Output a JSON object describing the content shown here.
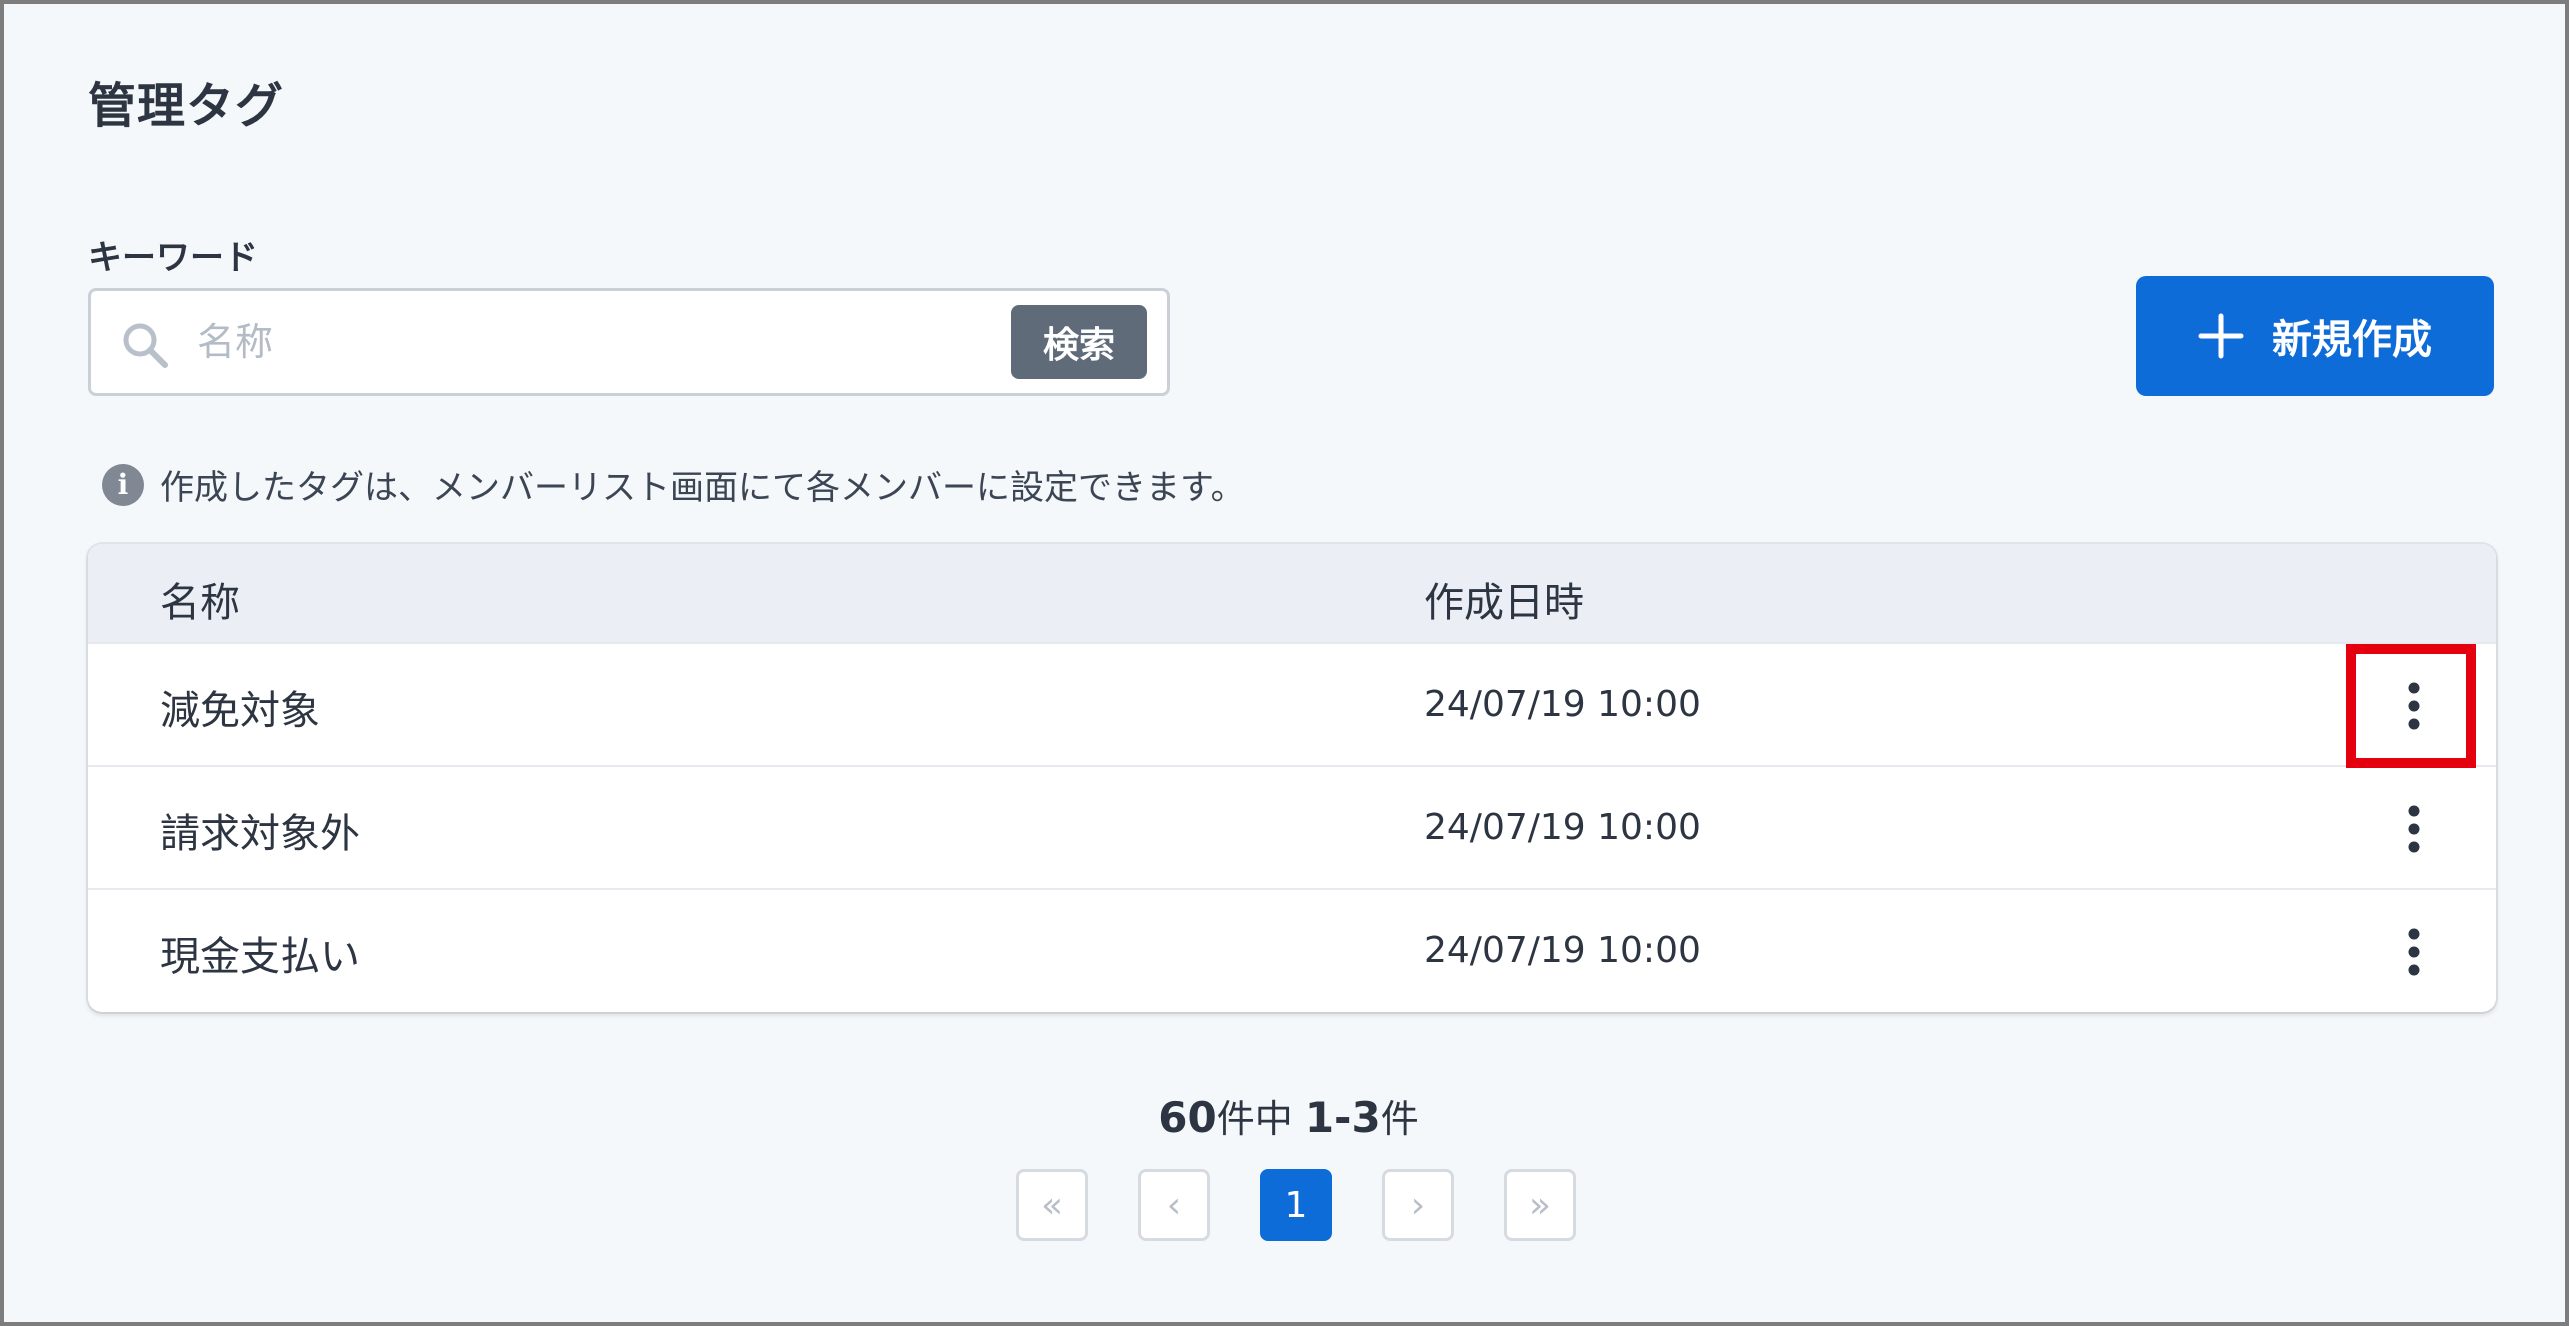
{
  "page": {
    "title": "管理タグ"
  },
  "search": {
    "label": "キーワード",
    "placeholder": "名称",
    "value": "",
    "button_label": "検索"
  },
  "actions": {
    "new_label": "新規作成"
  },
  "info": {
    "text": "作成したタグは、メンバーリスト画面にて各メンバーに設定できます。"
  },
  "table": {
    "columns": [
      "名称",
      "作成日時"
    ],
    "rows": [
      {
        "name": "減免対象",
        "created": "24/07/19 10:00"
      },
      {
        "name": "請求対象外",
        "created": "24/07/19 10:00"
      },
      {
        "name": "現金支払い",
        "created": "24/07/19 10:00"
      }
    ]
  },
  "pagination": {
    "total": "60",
    "total_suffix": "件中",
    "range": "1-3",
    "range_suffix": "件",
    "current_page": "1",
    "first_symbol": "«",
    "prev_symbol": "‹",
    "next_symbol": "›",
    "last_symbol": "»"
  },
  "icons": {
    "search": "search-icon",
    "plus": "plus-icon",
    "info": "info-icon",
    "more": "more-vertical-icon"
  },
  "colors": {
    "primary": "#0e6cd8",
    "search_button": "#5f6b78",
    "highlight": "#e4000f",
    "background": "#f5f8fb",
    "table_header": "#ebeff5"
  }
}
